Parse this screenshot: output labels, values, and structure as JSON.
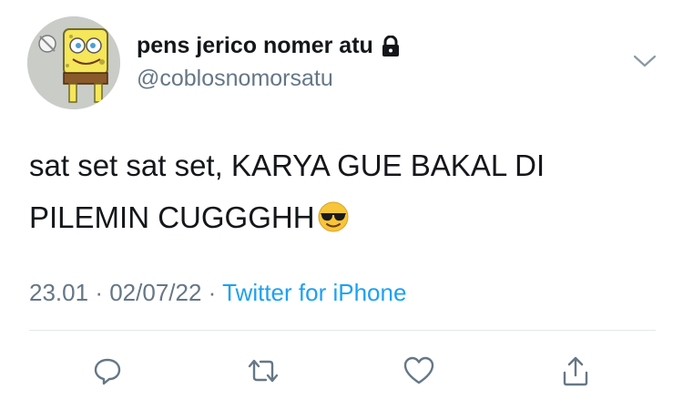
{
  "author": {
    "display_name": "pens jerico nomer atu",
    "handle": "@coblosnomorsatu",
    "protected_icon": "lock-icon",
    "avatar_icon": "cartoon-avatar"
  },
  "tweet": {
    "text": "sat set sat set, KARYA GUE BAKAL DI PILEMIN CUGGGHH",
    "emoji": "smiling-face-with-sunglasses"
  },
  "meta": {
    "time": "23.01",
    "separator": "·",
    "date": "02/07/22",
    "source": "Twitter for iPhone"
  },
  "actions": [
    {
      "name": "reply",
      "icon": "reply-icon"
    },
    {
      "name": "retweet",
      "icon": "retweet-icon"
    },
    {
      "name": "like",
      "icon": "heart-icon"
    },
    {
      "name": "share",
      "icon": "share-icon"
    }
  ],
  "colors": {
    "text": "#14171a",
    "secondary": "#657786",
    "link": "#1da1f2",
    "divider": "#e1e8ed"
  }
}
